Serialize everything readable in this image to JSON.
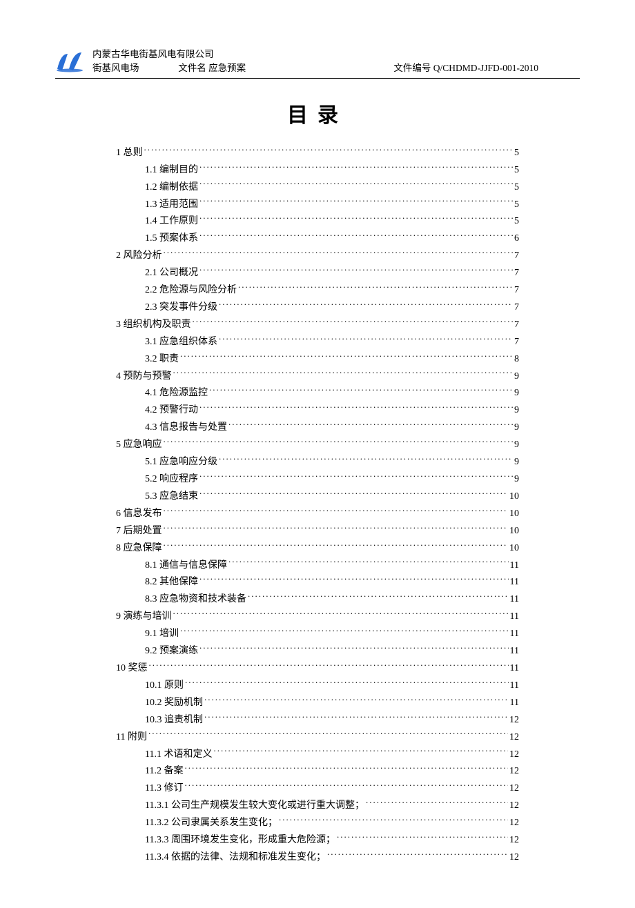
{
  "header": {
    "company": "内蒙古华电街基风电有限公司",
    "site": "街基风电场",
    "doc_name_label": "文件名",
    "doc_name": "应急预案",
    "doc_no_label": "文件编号",
    "doc_no": "Q/CHDMD-JJFD-001-2010"
  },
  "title": "目录",
  "toc": [
    {
      "level": 1,
      "label": "1 总则",
      "page": "5"
    },
    {
      "level": 2,
      "label": "1.1 编制目的",
      "page": "5"
    },
    {
      "level": 2,
      "label": "1.2 编制依据",
      "page": "5"
    },
    {
      "level": 2,
      "label": "1.3 适用范围",
      "page": "5"
    },
    {
      "level": 2,
      "label": "1.4 工作原则",
      "page": "5"
    },
    {
      "level": 2,
      "label": "1.5 预案体系",
      "page": "6"
    },
    {
      "level": 1,
      "label": "2 风险分析",
      "page": "7"
    },
    {
      "level": 2,
      "label": "2.1 公司概况",
      "page": "7"
    },
    {
      "level": 2,
      "label": "2.2 危险源与风险分析",
      "page": "7"
    },
    {
      "level": 2,
      "label": "2.3 突发事件分级",
      "page": "7"
    },
    {
      "level": 1,
      "label": "3 组织机构及职责",
      "page": "7"
    },
    {
      "level": 2,
      "label": "3.1 应急组织体系",
      "page": "7"
    },
    {
      "level": 2,
      "label": "3.2 职责",
      "page": "8"
    },
    {
      "level": 1,
      "label": "4 预防与预警",
      "page": "9"
    },
    {
      "level": 2,
      "label": "4.1 危险源监控",
      "page": "9"
    },
    {
      "level": 2,
      "label": "4.2 预警行动",
      "page": "9"
    },
    {
      "level": 2,
      "label": "4.3 信息报告与处置",
      "page": "9"
    },
    {
      "level": 1,
      "label": "5 应急响应",
      "page": "9"
    },
    {
      "level": 2,
      "label": "5.1 应急响应分级",
      "page": "9"
    },
    {
      "level": 2,
      "label": "5.2 响应程序",
      "page": "9"
    },
    {
      "level": 2,
      "label": "5.3 应急结束",
      "page": "10"
    },
    {
      "level": 1,
      "label": "6 信息发布",
      "page": "10"
    },
    {
      "level": 1,
      "label": "7 后期处置",
      "page": "10"
    },
    {
      "level": 1,
      "label": "8 应急保障",
      "page": "10"
    },
    {
      "level": 2,
      "label": "8.1 通信与信息保障",
      "page": "11"
    },
    {
      "level": 2,
      "label": "8.2 其他保障",
      "page": "11"
    },
    {
      "level": 2,
      "label": "8.3 应急物资和技术装备",
      "page": "11"
    },
    {
      "level": 1,
      "label": "9 演练与培训",
      "page": "11"
    },
    {
      "level": 2,
      "label": "9.1 培训",
      "page": "11"
    },
    {
      "level": 2,
      "label": "9.2 预案演练",
      "page": "11"
    },
    {
      "level": 1,
      "label": "10 奖惩",
      "page": "11"
    },
    {
      "level": 2,
      "label": "10.1 原则",
      "page": "11"
    },
    {
      "level": 2,
      "label": "10.2 奖励机制",
      "page": "11"
    },
    {
      "level": 2,
      "label": "10.3 追责机制",
      "page": "12"
    },
    {
      "level": 1,
      "label": "11 附则",
      "page": "12"
    },
    {
      "level": 2,
      "label": "11.1 术语和定义",
      "page": "12"
    },
    {
      "level": 2,
      "label": "11.2 备案",
      "page": "12"
    },
    {
      "level": 2,
      "label": "11.3 修订",
      "page": "12"
    },
    {
      "level": 3,
      "label": "11.3.1 公司生产规模发生较大变化或进行重大调整；",
      "page": "12"
    },
    {
      "level": 3,
      "label": "11.3.2 公司隶属关系发生变化；",
      "page": "12"
    },
    {
      "level": 3,
      "label": "11.3.3 周围环境发生变化，形成重大危险源；",
      "page": "12"
    },
    {
      "level": 3,
      "label": "11.3.4 依据的法律、法规和标准发生变化；",
      "page": "12"
    }
  ]
}
